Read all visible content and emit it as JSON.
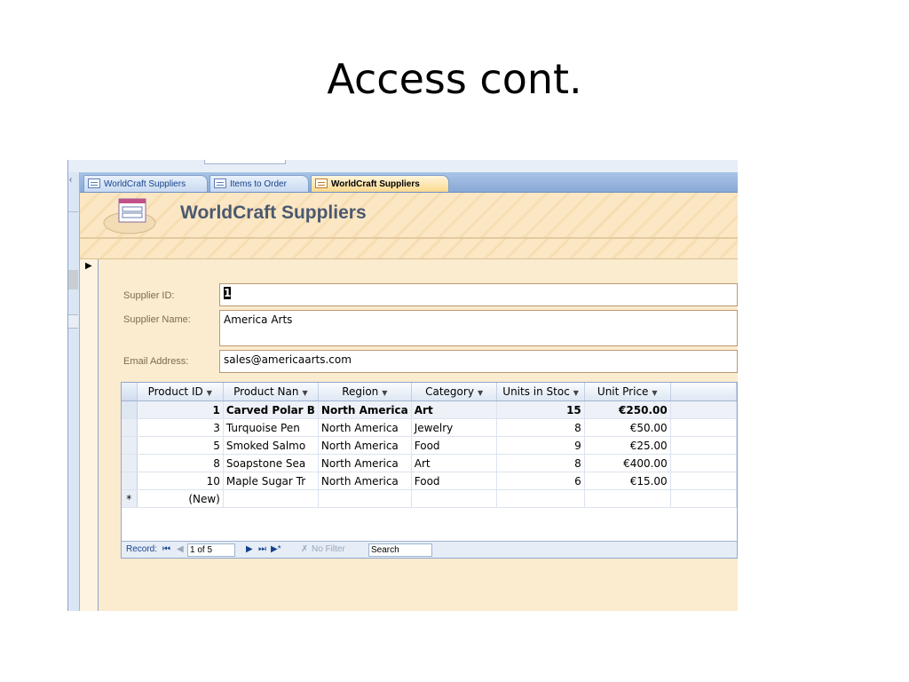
{
  "slide": {
    "title": "Access cont."
  },
  "tabs": [
    {
      "label": "WorldCraft Suppliers",
      "icon": "table-icon"
    },
    {
      "label": "Items to Order",
      "icon": "query-icon"
    },
    {
      "label": "WorldCraft Suppliers",
      "icon": "form-icon",
      "active": true
    }
  ],
  "form": {
    "title": "WorldCraft Suppliers",
    "supplier_id_label": "Supplier ID:",
    "supplier_id_value": "1",
    "supplier_name_label": "Supplier Name:",
    "supplier_name_value": "America Arts",
    "email_label": "Email Address:",
    "email_value": "sales@americaarts.com"
  },
  "subform": {
    "columns": [
      "Product ID",
      "Product Nan",
      "Region",
      "Category",
      "Units in Stoc",
      "Unit Price"
    ],
    "rows": [
      [
        "1",
        "Carved Polar B",
        "North America",
        "Art",
        "15",
        "€250.00"
      ],
      [
        "3",
        "Turquoise Pen",
        "North America",
        "Jewelry",
        "8",
        "€50.00"
      ],
      [
        "5",
        "Smoked Salmo",
        "North America",
        "Food",
        "9",
        "€25.00"
      ],
      [
        "8",
        "Soapstone Sea",
        "North America",
        "Art",
        "8",
        "€400.00"
      ],
      [
        "10",
        "Maple Sugar Tr",
        "North America",
        "Food",
        "6",
        "€15.00"
      ]
    ],
    "new_row_marker": "*",
    "new_row_label": "(New)"
  },
  "navbar": {
    "record_label": "Record:",
    "first": "⏮",
    "prev": "◀",
    "position": "1 of 5",
    "next": "▶",
    "last": "⏭",
    "new": "▶*",
    "filter_icon": "✗",
    "filter_label": "No Filter",
    "search_label": "Search"
  }
}
